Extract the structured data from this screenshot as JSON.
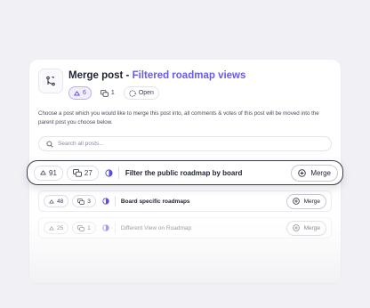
{
  "header": {
    "title_prefix": "Merge post -",
    "title_post": "Filtered roadmap views",
    "upvotes": "6",
    "comments": "1",
    "status": "Open"
  },
  "description": "Choose a post which you would like to merge this post into, all comments & votes of this post will be moved into the parent post you choose below.",
  "search": {
    "placeholder": "Search all posts..."
  },
  "posts": [
    {
      "votes": "91",
      "comments": "27",
      "title": "Filter the public roadmap by board",
      "merge_label": "Merge",
      "highlighted": true
    },
    {
      "votes": "48",
      "comments": "3",
      "title": "Board specific roadmaps",
      "merge_label": "Merge"
    },
    {
      "votes": "25",
      "comments": "1",
      "title": "Different View on Roadmap",
      "merge_label": "Merge"
    }
  ],
  "colors": {
    "accent": "#6a5be8",
    "status_ring": "#5a4de0",
    "background": "#f1f1f5"
  },
  "icons": [
    "merge-icon",
    "upvote-icon",
    "comment-icon",
    "status-circle-icon",
    "search-icon",
    "plus-circle-icon"
  ]
}
